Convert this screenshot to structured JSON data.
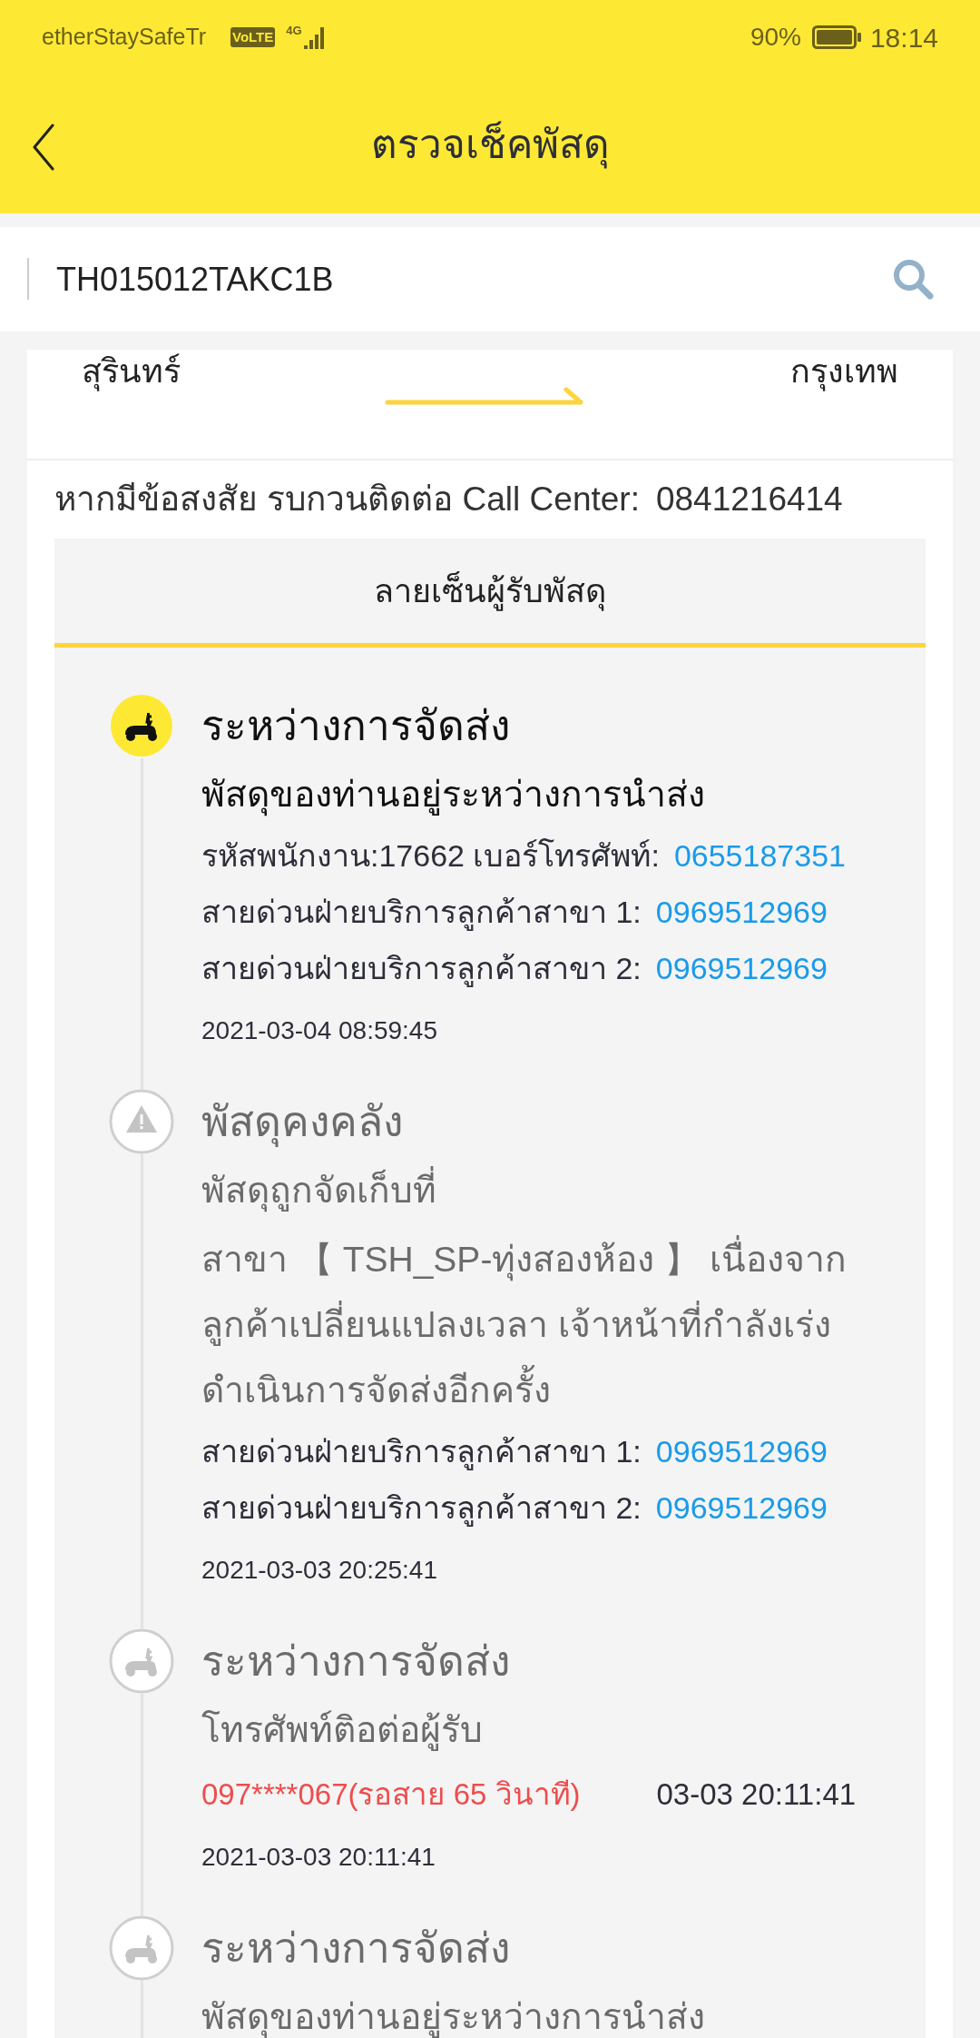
{
  "status_bar": {
    "carrier": "etherStaySafeTr",
    "volte": "VoLTE",
    "network": "4G",
    "battery_percent": "90%",
    "time": "18:14"
  },
  "header": {
    "title": "ตรวจเช็คพัสดุ"
  },
  "search": {
    "value": "TH015012TAKC1B"
  },
  "route": {
    "origin": "สุรินทร์",
    "destination": "กรุงเทพ"
  },
  "call_center": {
    "label": "หากมีข้อสงสัย รบกวนติดต่อ Call Center:",
    "phone": "0841216414"
  },
  "signature_tab": {
    "label": "ลายเซ็นผู้รับพัสดุ"
  },
  "events": [
    {
      "kind": "scooter",
      "active": true,
      "title": "ระหว่างการจัดส่ง",
      "lines": [
        {
          "kind": "text",
          "text": "พัสดุของท่านอยู่ระหว่างการนำส่ง"
        },
        {
          "kind": "contact",
          "label": "รหัสพนักงาน:17662  เบอร์โทรศัพท์:",
          "phone": "0655187351"
        },
        {
          "kind": "contact",
          "label": "สายด่วนฝ่ายบริการลูกค้าสาขา 1:",
          "phone": "0969512969"
        },
        {
          "kind": "contact",
          "label": "สายด่วนฝ่ายบริการลูกค้าสาขา 2:",
          "phone": "0969512969"
        }
      ],
      "time": "2021-03-04 08:59:45"
    },
    {
      "kind": "warning",
      "active": false,
      "title": "พัสดุคงคลัง",
      "lines": [
        {
          "kind": "text",
          "text": "พัสดุถูกจัดเก็บที่"
        },
        {
          "kind": "text",
          "text": "สาขา 【 TSH_SP-ทุ่งสองห้อง 】 เนื่องจากลูกค้าเปลี่ยนแปลงเวลา เจ้าหน้าที่กำลังเร่งดำเนินการจัดส่งอีกครั้ง"
        },
        {
          "kind": "contact",
          "label": "สายด่วนฝ่ายบริการลูกค้าสาขา 1:",
          "phone": "0969512969"
        },
        {
          "kind": "contact",
          "label": "สายด่วนฝ่ายบริการลูกค้าสาขา 2:",
          "phone": "0969512969"
        }
      ],
      "time": "2021-03-03 20:25:41"
    },
    {
      "kind": "scooter",
      "active": false,
      "title": "ระหว่างการจัดส่ง",
      "lines": [
        {
          "kind": "text",
          "text": "โทรศัพท์ติอต่อผู้รับ"
        },
        {
          "kind": "call",
          "text": "097****067(รอสาย 65 วินาที)",
          "time": "03-03 20:11:41"
        }
      ],
      "time": "2021-03-03 20:11:41"
    },
    {
      "kind": "scooter",
      "active": false,
      "title": "ระหว่างการจัดส่ง",
      "lines": [
        {
          "kind": "text",
          "text": "พัสดุของท่านอยู่ระหว่างการนำส่ง"
        }
      ]
    }
  ]
}
